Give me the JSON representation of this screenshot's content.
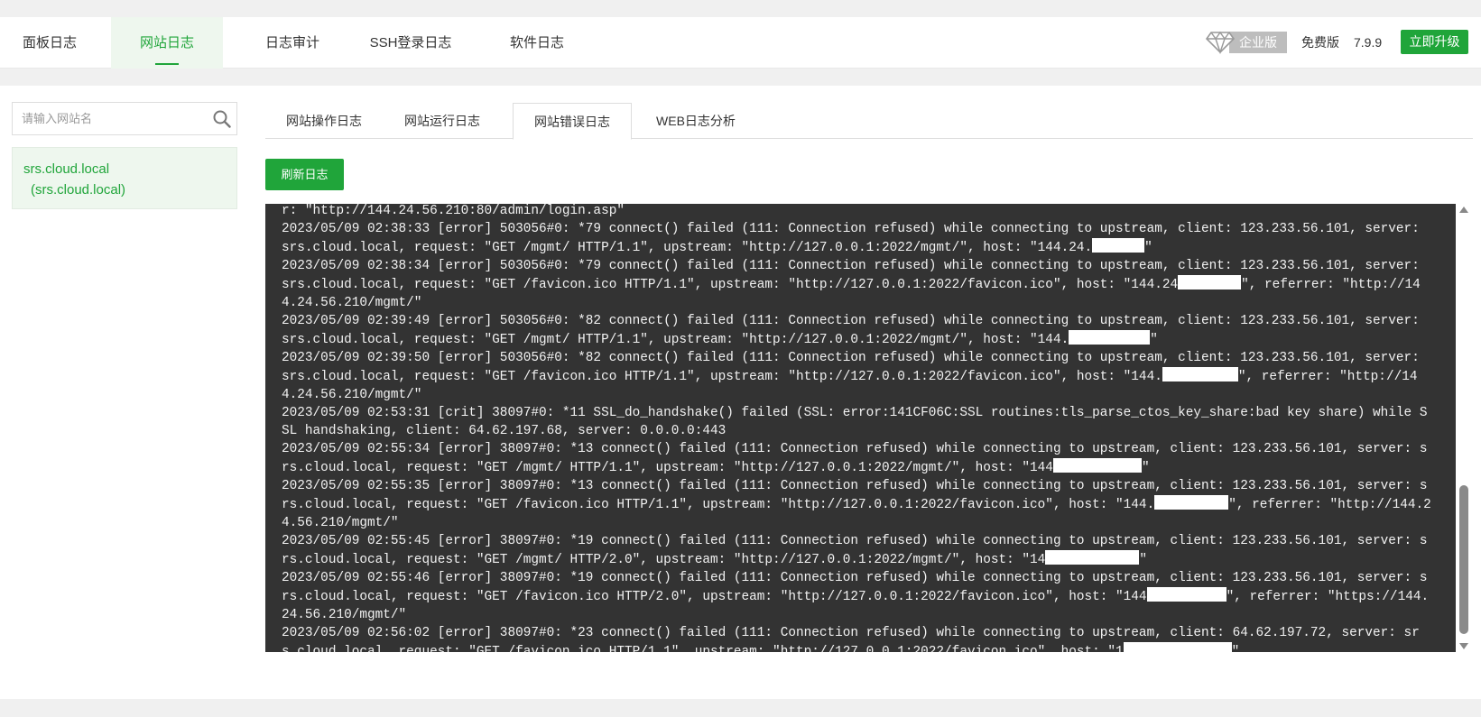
{
  "top_tabs": [
    {
      "label": "面板日志",
      "active": false
    },
    {
      "label": "网站日志",
      "active": true
    },
    {
      "label": "日志审计",
      "active": false
    },
    {
      "label": "SSH登录日志",
      "active": false
    },
    {
      "label": "软件日志",
      "active": false
    }
  ],
  "header": {
    "enterprise_label": "企业版",
    "edition_label": "免费版",
    "version": "7.9.9",
    "upgrade_label": "立即升级"
  },
  "sidebar": {
    "search_placeholder": "请输入网站名",
    "sites": [
      {
        "name": "srs.cloud.local",
        "alias": "(srs.cloud.local)",
        "selected": true
      }
    ]
  },
  "sub_tabs": [
    {
      "label": "网站操作日志",
      "active": false
    },
    {
      "label": "网站运行日志",
      "active": false
    },
    {
      "label": "网站错误日志",
      "active": true
    },
    {
      "label": "WEB日志分析",
      "active": false
    }
  ],
  "refresh_label": "刷新日志",
  "log_lines": [
    "r: \"http://144.24.56.210:80/admin/login.asp\"",
    "2023/05/09 02:38:33 [error] 503056#0: *79 connect() failed (111: Connection refused) while connecting to upstream, client: 123.233.56.101, server: srs.cloud.local, request: \"GET /mgmt/ HTTP/1.1\", upstream: \"http://127.0.0.1:2022/mgmt/\", host: \"144.24.",
    "2023/05/09 02:38:34 [error] 503056#0: *79 connect() failed (111: Connection refused) while connecting to upstream, client: 123.233.56.101, server: srs.cloud.local, request: \"GET /favicon.ico HTTP/1.1\", upstream: \"http://127.0.0.1:2022/favicon.ico\", host: \"144.24",
    "\", referrer: \"http://144.24.56.210/mgmt/\"",
    "2023/05/09 02:39:49 [error] 503056#0: *82 connect() failed (111: Connection refused) while connecting to upstream, client: 123.233.56.101, server: srs.cloud.local, request: \"GET /mgmt/ HTTP/1.1\", upstream: \"http://127.0.0.1:2022/mgmt/\", host: \"144.",
    "2023/05/09 02:39:50 [error] 503056#0: *82 connect() failed (111: Connection refused) while connecting to upstream, client: 123.233.56.101, server: srs.cloud.local, request: \"GET /favicon.ico HTTP/1.1\", upstream: \"http://127.0.0.1:2022/favicon.ico\", host: \"144.",
    "\", referrer: \"http://144.24.56.210/mgmt/\"",
    "2023/05/09 02:53:31 [crit] 38097#0: *11 SSL_do_handshake() failed (SSL: error:141CF06C:SSL routines:tls_parse_ctos_key_share:bad key share) while SSL handshaking, client: 64.62.197.68, server: 0.0.0.0:443",
    "2023/05/09 02:55:34 [error] 38097#0: *13 connect() failed (111: Connection refused) while connecting to upstream, client: 123.233.56.101, server: srs.cloud.local, request: \"GET /mgmt/ HTTP/1.1\", upstream: \"http://127.0.0.1:2022/mgmt/\", host: \"144",
    "2023/05/09 02:55:35 [error] 38097#0: *13 connect() failed (111: Connection refused) while connecting to upstream, client: 123.233.56.101, server: srs.cloud.local, request: \"GET /favicon.ico HTTP/1.1\", upstream: \"http://127.0.0.1:2022/favicon.ico\", host: \"144.",
    "\", referrer: \"http://144.24.56.210/mgmt/\"",
    "2023/05/09 02:55:45 [error] 38097#0: *19 connect() failed (111: Connection refused) while connecting to upstream, client: 123.233.56.101, server: srs.cloud.local, request: \"GET /mgmt/ HTTP/2.0\", upstream: \"http://127.0.0.1:2022/mgmt/\", host: \"14",
    "2023/05/09 02:55:46 [error] 38097#0: *19 connect() failed (111: Connection refused) while connecting to upstream, client: 123.233.56.101, server: srs.cloud.local, request: \"GET /favicon.ico HTTP/2.0\", upstream: \"http://127.0.0.1:2022/favicon.ico\", host: \"144",
    "\", referrer: \"https://144.24.56.210/mgmt/\"",
    "2023/05/09 02:56:02 [error] 38097#0: *23 connect() failed (111: Connection refused) while connecting to upstream, client: 64.62.197.72, server: srs.cloud.local, request: \"GET /favicon.ico HTTP/1.1\", upstream: \"http://127.0.0.1:2022/favicon.ico\", host: \"1",
    "\""
  ],
  "colors": {
    "accent": "#20a53a",
    "log_bg": "#333333",
    "log_text": "#f2f2f2"
  },
  "icons": {
    "diamond": "diamond-icon",
    "search": "search-icon",
    "scroll_up": "triangle-up-icon",
    "scroll_down": "triangle-down-icon"
  }
}
